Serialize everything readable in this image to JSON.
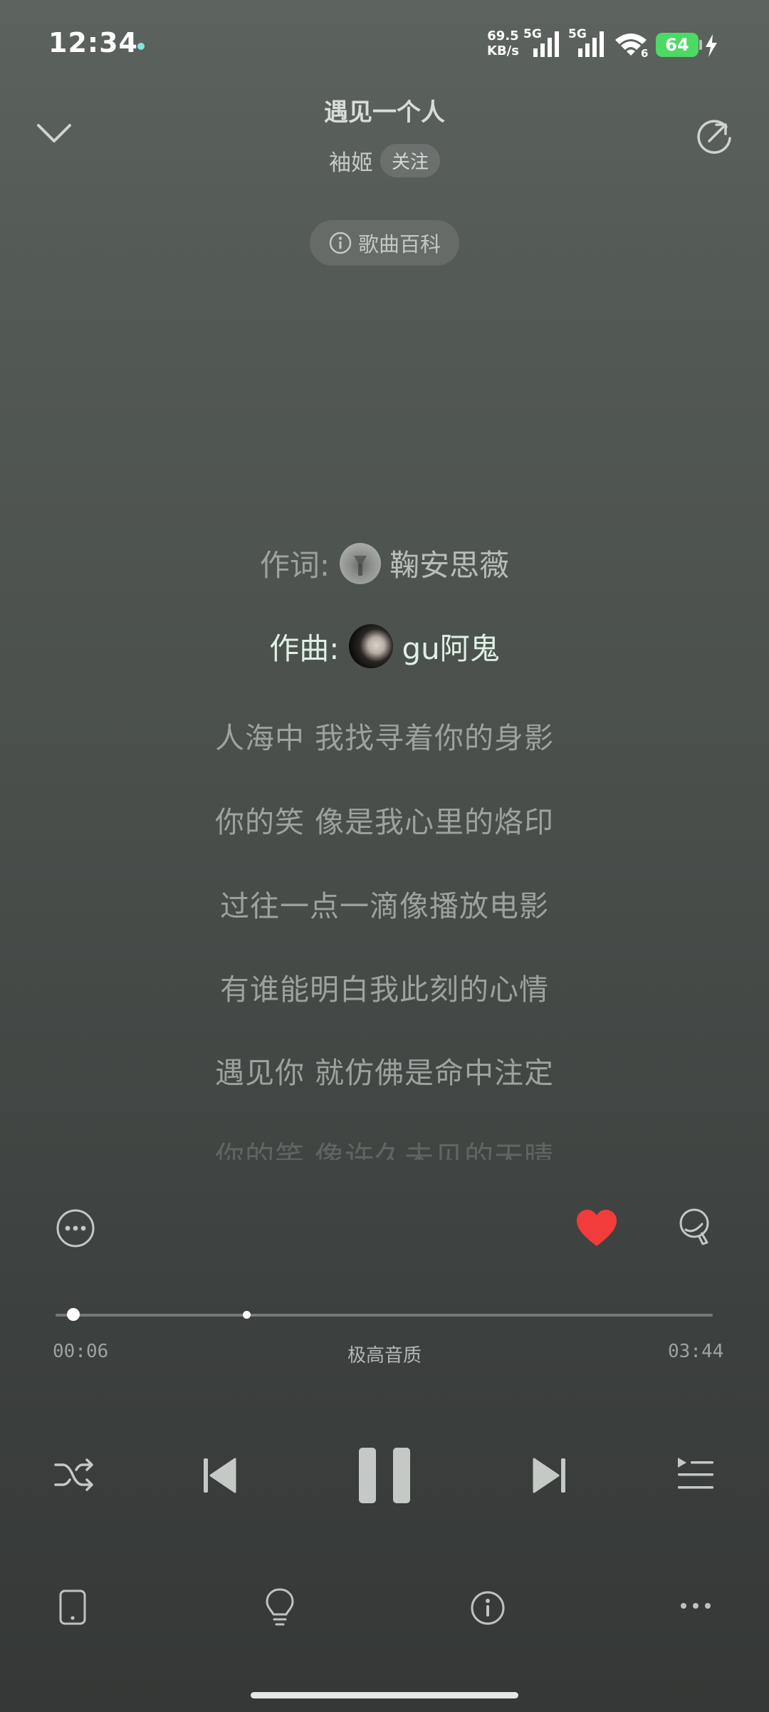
{
  "status_bar": {
    "time": "12:34",
    "net_speed_value": "69.5",
    "net_speed_unit": "KB/s",
    "sim1_label": "5G",
    "sim2_label": "5G",
    "wifi_label": "6",
    "battery": "64"
  },
  "header": {
    "title": "遇见一个人",
    "artist": "袖姬",
    "follow_label": "关注",
    "wiki_label": "歌曲百科"
  },
  "credits": {
    "lyricist_label": "作词:",
    "lyricist_name": "鞠安思薇",
    "composer_label": "作曲:",
    "composer_name": "gu阿鬼"
  },
  "lyrics": [
    "人海中 我找寻着你的身影",
    "你的笑 像是我心里的烙印",
    "过往一点一滴像播放电影",
    "有谁能明白我此刻的心情",
    "遇见你 就仿佛是命中注定",
    "你的笑 像许久未见的天晴"
  ],
  "player": {
    "current_time": "00:06",
    "total_time": "03:44",
    "quality_label": "极高音质",
    "progress": 0.027,
    "liked": true
  },
  "colors": {
    "like": "#f23b3b",
    "battery": "#4cd964",
    "active_credit": "#dff0e4"
  },
  "icons": {
    "collapse": "chevron-down-icon",
    "share": "refresh-share-icon",
    "more_options": "more-circle-icon",
    "like": "heart-icon",
    "comment": "comment-icon",
    "shuffle": "shuffle-icon",
    "previous": "previous-icon",
    "pause": "pause-icon",
    "next": "next-icon",
    "playlist": "playlist-icon",
    "device": "device-icon",
    "tips": "lightbulb-icon",
    "info": "info-icon",
    "more": "more-dots-icon"
  }
}
